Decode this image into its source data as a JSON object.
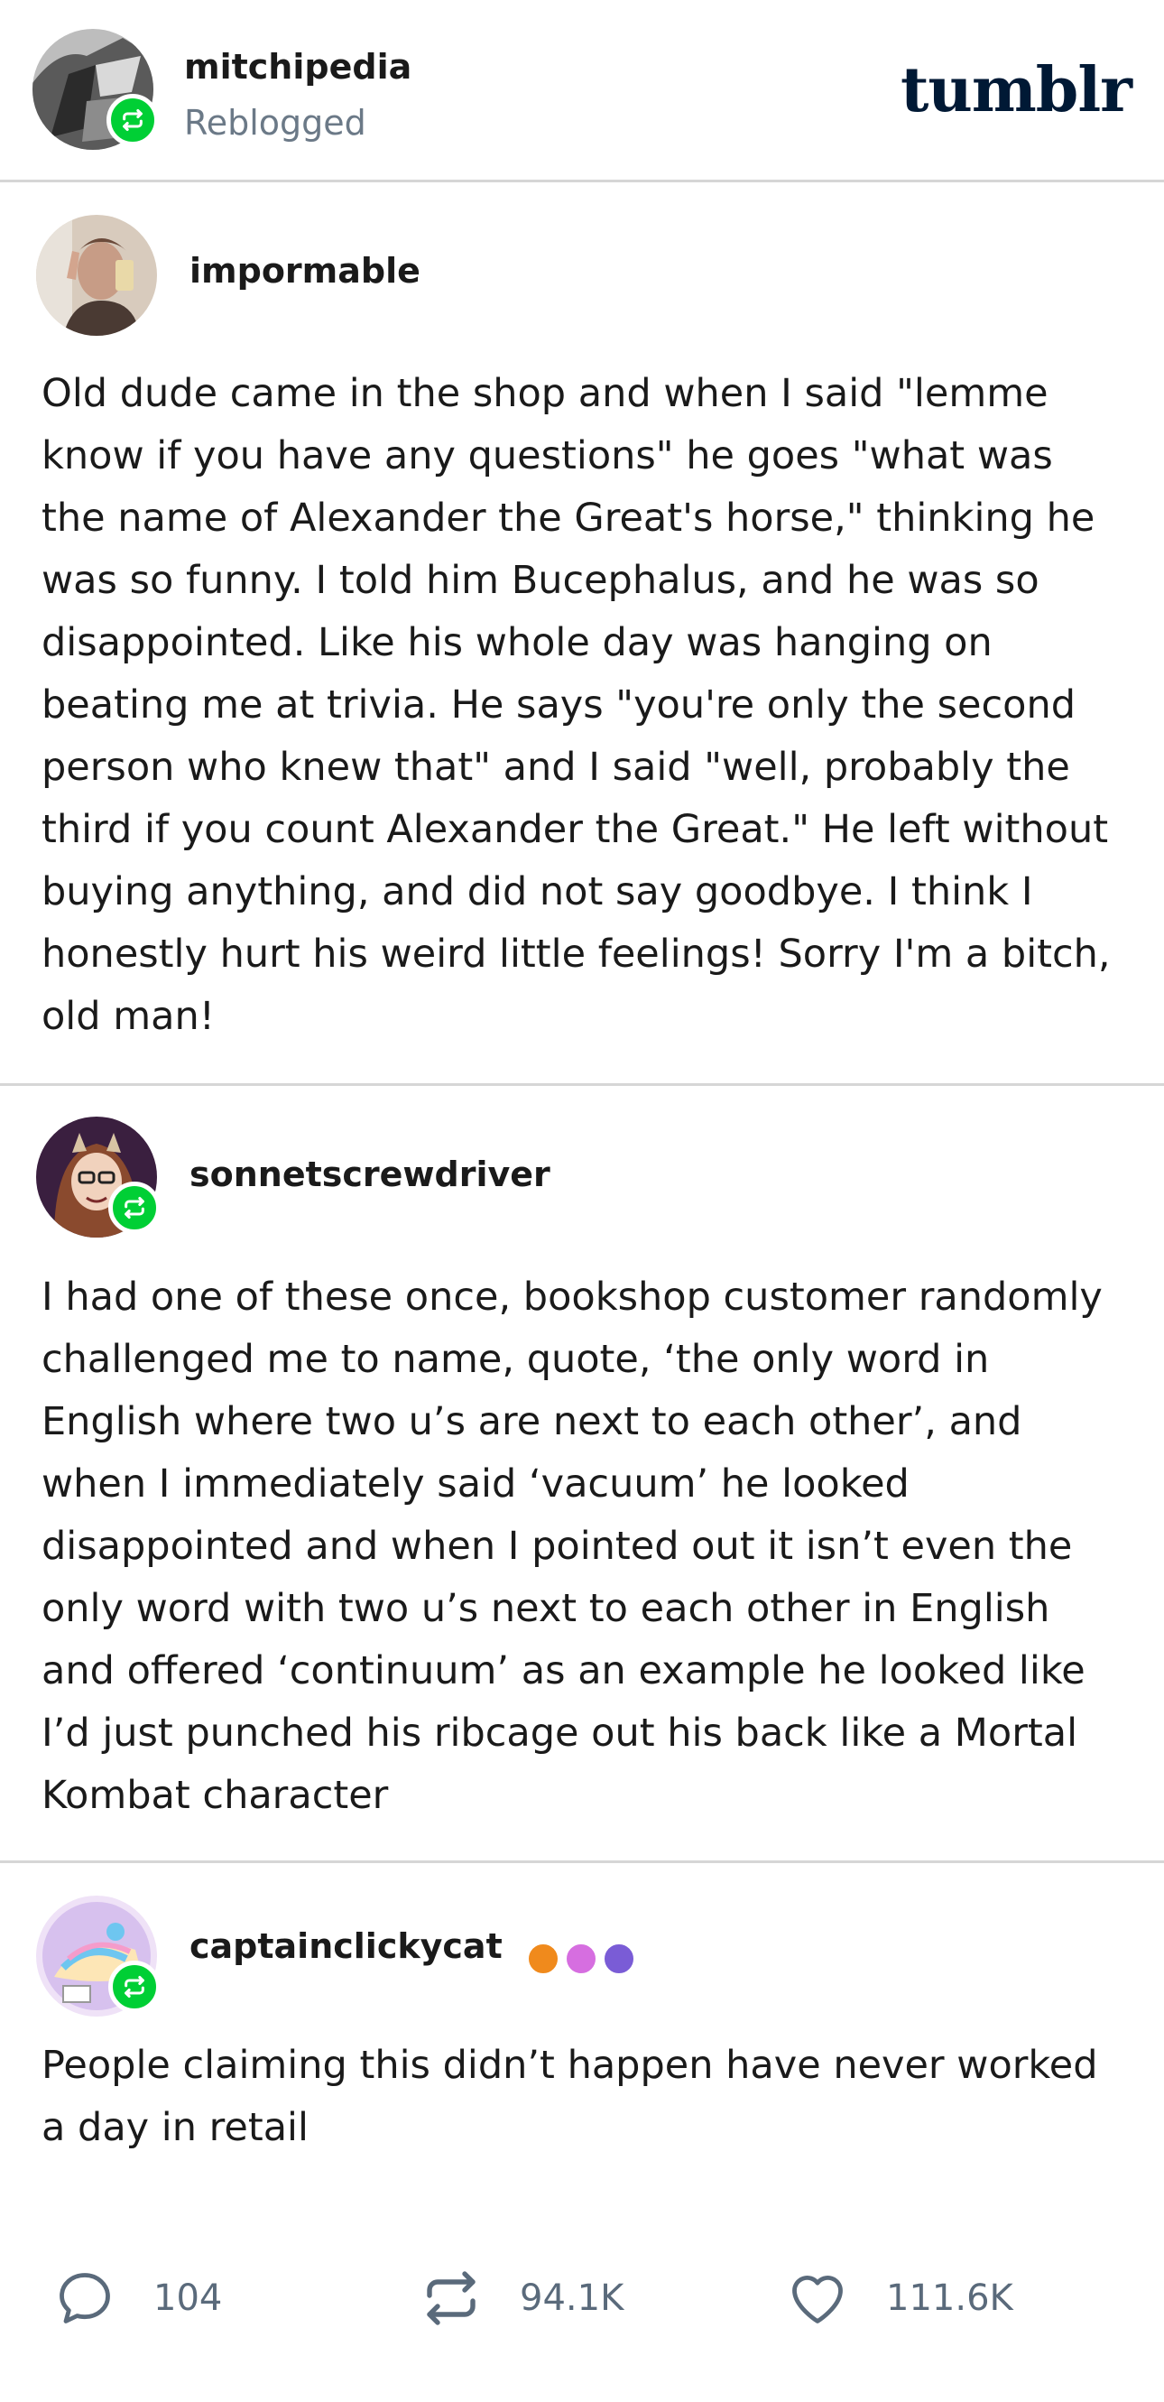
{
  "header": {
    "blog_name": "mitchipedia",
    "status": "Reblogged",
    "brand": "tumblr"
  },
  "posts": [
    {
      "username": "impormable",
      "reblog_badge": false,
      "text": "Old dude came in the shop and when I said \"lemme know if you have any questions\" he goes \"what was the name of Alexander the Great's horse,\" thinking he was so funny. I told him Bucephalus, and he was so disappointed. Like his whole day was hanging on beating me at trivia. He says \"you're only the second person who knew that\" and I said \"well, probably the third if you count Alexander the Great.\" He left without buying anything, and did not say goodbye. I think I honestly hurt his weird little feelings! Sorry I'm a bitch, old man!"
    },
    {
      "username": "sonnetscrewdriver",
      "reblog_badge": true,
      "text": "I had one of these once, bookshop customer randomly challenged me to name, quote, ‘the only word in English where two u’s are next to each other’, and when I immediately said ‘vacuum’ he looked disappointed and when I pointed out it isn’t even the only word with two u’s next to each other in English and offered ‘continuum’ as an example he looked like I’d just punched his ribcage out his back like a Mortal Kombat character"
    },
    {
      "username": "captainclickycat",
      "reblog_badge": true,
      "text": "People claiming this didn’t happen have never worked a day in retail"
    }
  ],
  "stats": {
    "replies": "104",
    "reblogs": "94.1K",
    "likes": "111.6K"
  },
  "colors": {
    "reblog_green": "#00cf35",
    "brand_navy": "#001935",
    "muted": "#6b7987",
    "divider": "#d6d6d6"
  },
  "icons": [
    "reblog-icon",
    "reply-icon",
    "like-icon",
    "paw-badge-icon"
  ]
}
